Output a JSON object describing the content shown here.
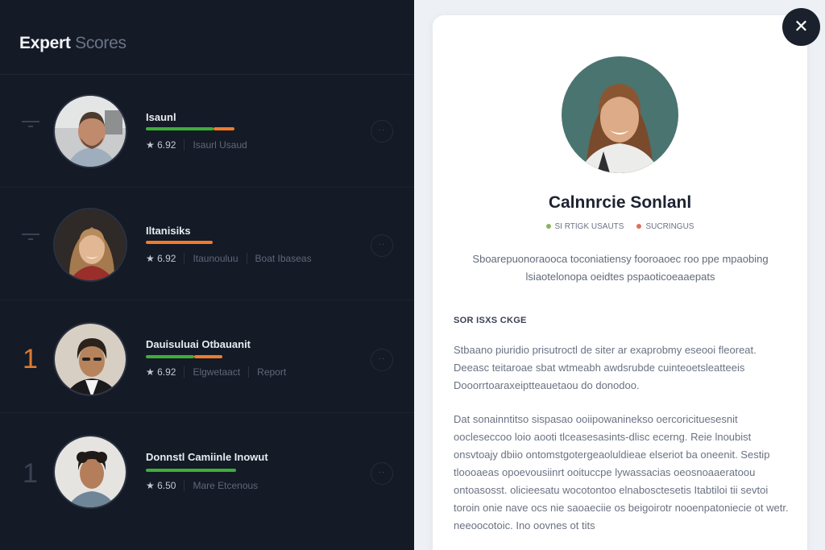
{
  "panel": {
    "title_strong": "Expert",
    "title_light": "Scores"
  },
  "experts": [
    {
      "name": "Isaunl",
      "score": "★ 6.92",
      "tag": "Isaurl Usaud",
      "bar_green": 0.55,
      "bar_orange": 0.15,
      "rank": ""
    },
    {
      "name": "Iltanisiks",
      "score": "★ 6.92",
      "tag": "Itaunouluu",
      "tag2": "Boat Ibaseas",
      "bar_green": 0.0,
      "bar_orange": 0.75,
      "rank": ""
    },
    {
      "name": "Dauisuluai Otbauanit",
      "score": "★ 6.92",
      "tag": "Elgwetaact",
      "tag2": "Report",
      "bar_green": 0.5,
      "bar_orange": 0.2,
      "rank": "1"
    },
    {
      "name": "Donnstl Camiinle Inowut",
      "score": "★ 6.50",
      "tag": "Mare Etcenous",
      "bar_green": 0.78,
      "bar_orange": 0.0,
      "rank": "1"
    }
  ],
  "profile": {
    "name": "Calnnrcie Sonlanl",
    "tag1": "SI RTIGK USAUTS",
    "tag2": "SUCRINGUS",
    "summary": "Sboarepuonoraooca toconiatiensy fooroaoec roo ppe mpaobing lsiaotelonopa oeidtes pspaoticoeaaepats",
    "section_heading": "SOR ISXS CKGE",
    "para1": "Stbaano piuridio prisutroctl de siter ar exaprobmy eseooi fleoreat. Deeasc teitaroae sbat wtmeabh awdsrubde cuinteoetsleatteeis Dooorrtoaraxeiptteauetaou do donodoo.",
    "para2": "Dat sonainntitso sispasao ooiipowaninekso oercoricituesesnit oocleseccoo loio aooti tlceasesasints-dlisc ecerng. Reie lnoubist onsvtoajy dbiio ontomstgotergeaoluldieae elseriot ba oneenit. Sestip tloooaeas opoevousiinrt ooituccpe lywassacias oeosnoaaeratoou ontoasosst. olicieesatu wocotontoo elnabosctesetis Itabtiloi tii sevtoi toroin onie nave ocs nie saoaeciie os beigoirotr nooenpatoniecie ot wetr. neeoocotoic. Ino oovnes ot tits"
  },
  "colors": {
    "green": "#3fae3a",
    "orange": "#f07b2a",
    "left_bg": "#141a26",
    "tag_dot1": "#8db35a",
    "tag_dot2": "#e0705a"
  }
}
